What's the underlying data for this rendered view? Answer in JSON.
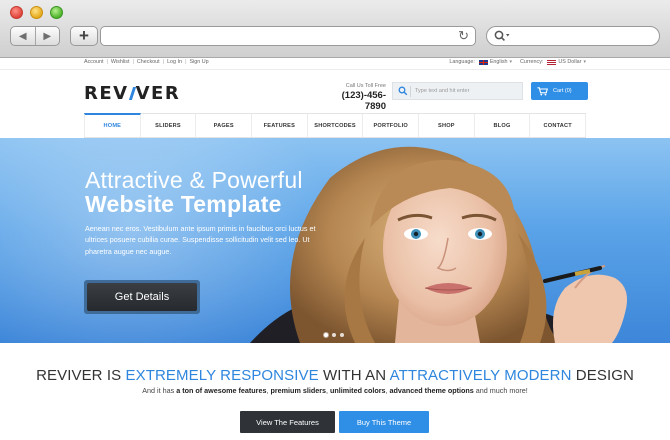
{
  "browser": {
    "back_glyph": "◀",
    "forward_glyph": "▶",
    "newtab_glyph": "+",
    "reload_glyph": "↻",
    "url": ""
  },
  "topbar": {
    "links": [
      "Account",
      "Wishlist",
      "Checkout",
      "Log In",
      "Sign Up"
    ],
    "language_label": "Language:",
    "language_value": "English",
    "currency_label": "Currency:",
    "currency_value": "US Dollar"
  },
  "header": {
    "logo_left": "REV",
    "logo_right": "VER",
    "call_label": "Call Us Toll Free",
    "phone": "(123)-456-7890",
    "search_placeholder": "Type text and hit enter",
    "cart_label": "Cart (0)"
  },
  "nav": {
    "items": [
      "HOME",
      "SLIDERS",
      "PAGES",
      "FEATURES",
      "SHORTCODES",
      "PORTFOLIO",
      "SHOP",
      "BLOG",
      "CONTACT"
    ],
    "active_index": 0
  },
  "hero": {
    "title_line1": "Attractive & Powerful",
    "title_line2": "Website Template",
    "body": "Aenean nec eros. Vestibulum ante ipsum primis in faucibus orci luctus et ultrices posuere cubilia curae. Suspendisse sollicitudin velit sed leo. Ut pharetra augue nec augue.",
    "cta_label": "Get Details",
    "slide_count": 3,
    "active_slide": 0
  },
  "promo": {
    "tagline_parts": [
      "REVIVER IS ",
      "EXTREMELY RESPONSIVE",
      " WITH AN ",
      "ATTRACTIVELY MODERN",
      " DESIGN"
    ],
    "subline_parts": [
      "And it has ",
      "a ton of awesome features",
      ", ",
      "premium sliders",
      ", ",
      "unlimited colors",
      ", ",
      "advanced theme options",
      " and much more!"
    ],
    "features_button": "View The Features",
    "buy_button": "Buy This Theme"
  },
  "colors": {
    "accent": "#2e86de",
    "cart": "#2f8fe6",
    "dark_button": "#2f3338"
  }
}
